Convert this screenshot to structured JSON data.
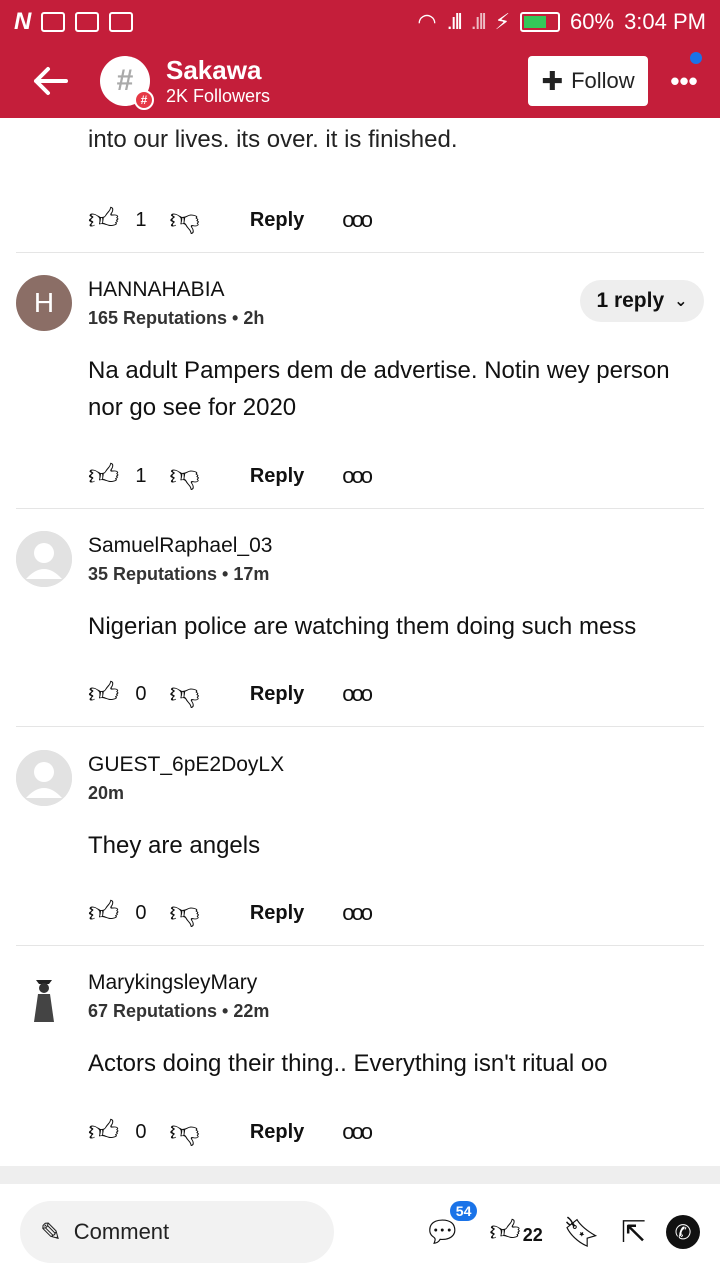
{
  "status_bar": {
    "battery": "60%",
    "time": "3:04 PM"
  },
  "header": {
    "back_icon": "back-arrow-icon",
    "title": "Sakawa",
    "followers": "2K Followers",
    "follow_label": "Follow",
    "more_label": "•••"
  },
  "cut_comment": {
    "text": "into our lives. its over. it is finished.",
    "likes": "1",
    "reply": "Reply"
  },
  "comments": [
    {
      "name": "HANNAHABIA",
      "meta": "165 Reputations • 2h",
      "avatar_letter": "H",
      "body": "Na adult Pampers dem de advertise. Notin wey person nor go see for 2020",
      "likes": "1",
      "reply": "Reply",
      "replies_label": "1 reply"
    },
    {
      "name": "SamuelRaphael_03",
      "meta": "35 Reputations • 17m",
      "body": "Nigerian police are watching them doing such mess",
      "likes": "0",
      "reply": "Reply"
    },
    {
      "name": "GUEST_6pE2DoyLX",
      "meta": "20m",
      "body": "They are angels",
      "likes": "0",
      "reply": "Reply"
    },
    {
      "name": "MarykingsleyMary",
      "meta": "67 Reputations • 22m",
      "body": "Actors doing their thing.. Everything isn't ritual oo",
      "likes": "0",
      "reply": "Reply"
    }
  ],
  "bottom_bar": {
    "comment_label": "Comment",
    "comments_badge": "54",
    "likes": "22"
  }
}
